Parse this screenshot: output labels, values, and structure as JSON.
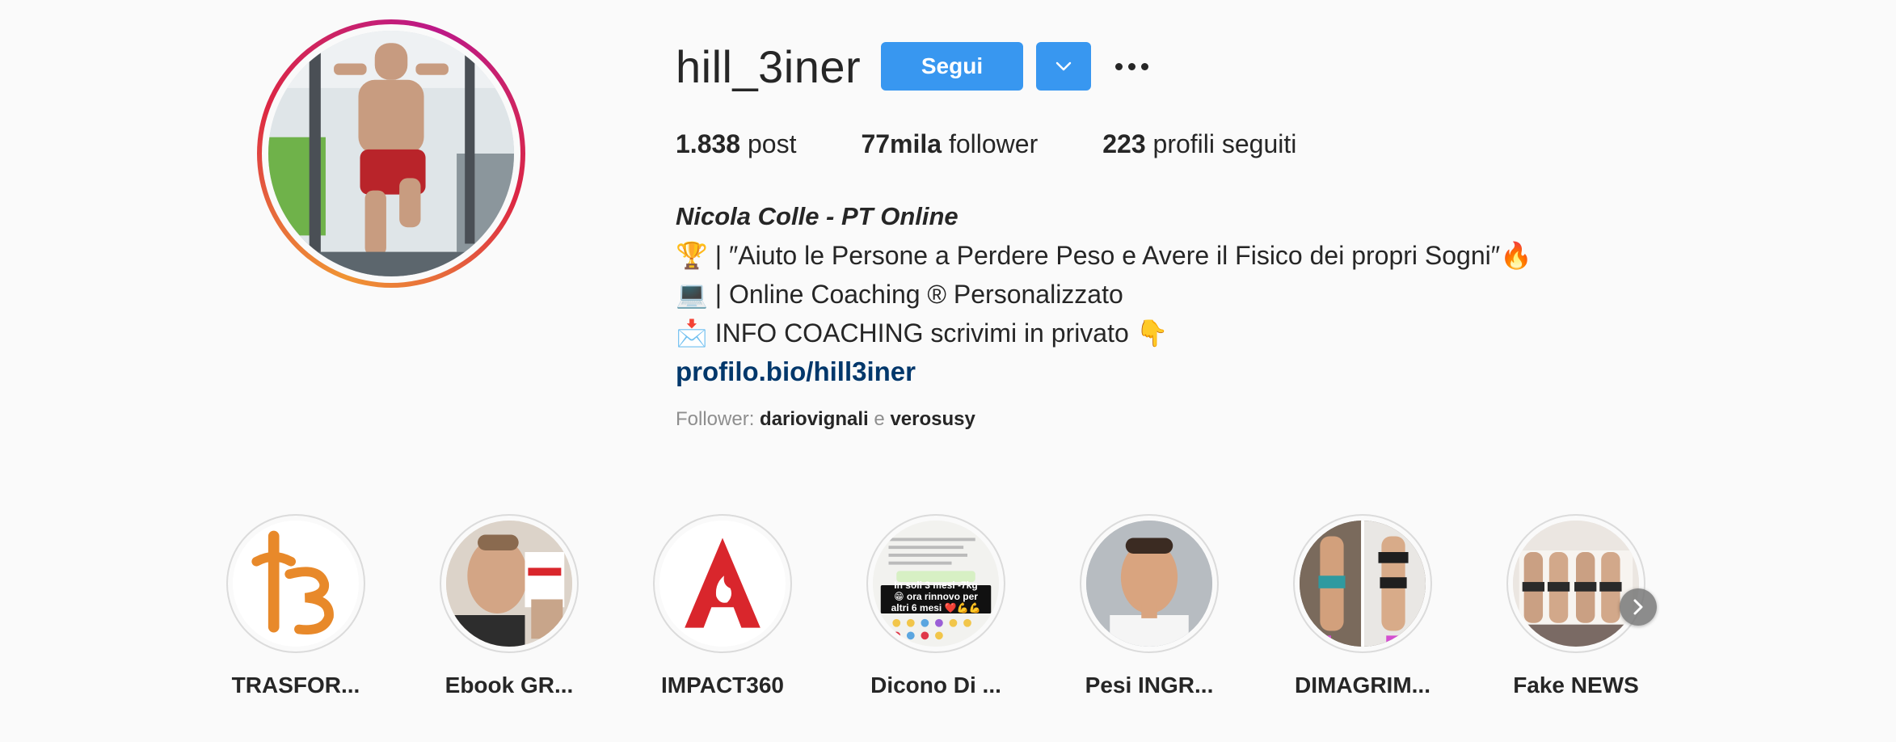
{
  "profile": {
    "username": "hill_3iner",
    "follow_label": "Segui"
  },
  "stats": {
    "posts_count": "1.838",
    "posts_label": "post",
    "followers_count": "77mila",
    "followers_label": "follower",
    "following_count": "223",
    "following_label": "profili seguiti"
  },
  "bio": {
    "name": "Nicola Colle - PT Online",
    "line1": "🏆 | ″Aiuto le Persone a Perdere Peso e Avere il Fisico dei propri Sogni″🔥",
    "line2": "💻 | Online Coaching ® Personalizzato",
    "line3": "📩 INFO COACHING scrivimi in privato 👇",
    "link": "profilo.bio/hill3iner"
  },
  "followed_by": {
    "prefix": "Follower:",
    "user1": "dariovignali",
    "conj": "e",
    "user2": "verosusy"
  },
  "highlights": [
    {
      "label": "TRASFOR...",
      "icon": "h3-logo"
    },
    {
      "label": "Ebook GR...",
      "icon": "face-photo"
    },
    {
      "label": "IMPACT360",
      "icon": "impact-logo"
    },
    {
      "label": "Dicono Di ...",
      "icon": "chat-screenshot",
      "overlay": "In soli 3 mesi -7kg 😁 ora rinnovo per altri 6 mesi ❤️💪💪"
    },
    {
      "label": "Pesi INGR...",
      "icon": "face-photo"
    },
    {
      "label": "DIMAGRIM...",
      "icon": "body-photo"
    },
    {
      "label": "Fake NEWS",
      "icon": "body-photo"
    }
  ],
  "colors": {
    "accent": "#3897f0",
    "link": "#00376b",
    "muted": "#8e8e8e",
    "text": "#262626",
    "h3_orange": "#e8892a",
    "impact_red": "#d9262c"
  }
}
